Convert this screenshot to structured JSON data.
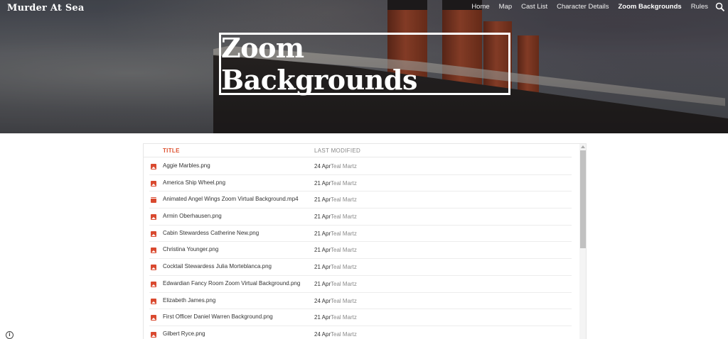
{
  "site": {
    "brand": "Murder At Sea"
  },
  "nav": [
    {
      "label": "Home",
      "active": false
    },
    {
      "label": "Map",
      "active": false
    },
    {
      "label": "Cast List",
      "active": false
    },
    {
      "label": "Character Details",
      "active": false
    },
    {
      "label": "Zoom Backgrounds",
      "active": true
    },
    {
      "label": "Rules",
      "active": false
    }
  ],
  "hero": {
    "title": "Zoom Backgrounds"
  },
  "file_list": {
    "columns": {
      "title": "TITLE",
      "last_modified": "LAST MODIFIED"
    },
    "files": [
      {
        "name": "Aggie Marbles.png",
        "date": "24 Apr",
        "owner": "Teal Martz",
        "type": "image"
      },
      {
        "name": "America Ship Wheel.png",
        "date": "21 Apr",
        "owner": "Teal Martz",
        "type": "image"
      },
      {
        "name": "Animated Angel Wings Zoom Virtual Background.mp4",
        "date": "21 Apr",
        "owner": "Teal Martz",
        "type": "video"
      },
      {
        "name": "Armin Oberhausen.png",
        "date": "21 Apr",
        "owner": "Teal Martz",
        "type": "image"
      },
      {
        "name": "Cabin Stewardess Catherine New.png",
        "date": "21 Apr",
        "owner": "Teal Martz",
        "type": "image"
      },
      {
        "name": "Christina Younger.png",
        "date": "21 Apr",
        "owner": "Teal Martz",
        "type": "image"
      },
      {
        "name": "Cocktail Stewardess Julia Morteblanca.png",
        "date": "21 Apr",
        "owner": "Teal Martz",
        "type": "image"
      },
      {
        "name": "Edwardian Fancy Room Zoom Virtual Background.png",
        "date": "21 Apr",
        "owner": "Teal Martz",
        "type": "image"
      },
      {
        "name": "Elizabeth James.png",
        "date": "24 Apr",
        "owner": "Teal Martz",
        "type": "image"
      },
      {
        "name": "First Officer Daniel Warren Background.png",
        "date": "21 Apr",
        "owner": "Teal Martz",
        "type": "image"
      },
      {
        "name": "Gilbert Ryce.png",
        "date": "24 Apr",
        "owner": "Teal Martz",
        "type": "image"
      }
    ]
  },
  "icons": {
    "search": "search-icon",
    "info": "info-icon",
    "image_file": "image-file-icon",
    "video_file": "video-file-icon"
  },
  "colors": {
    "accent": "#dd5130",
    "file_icon": "#d9492f"
  }
}
